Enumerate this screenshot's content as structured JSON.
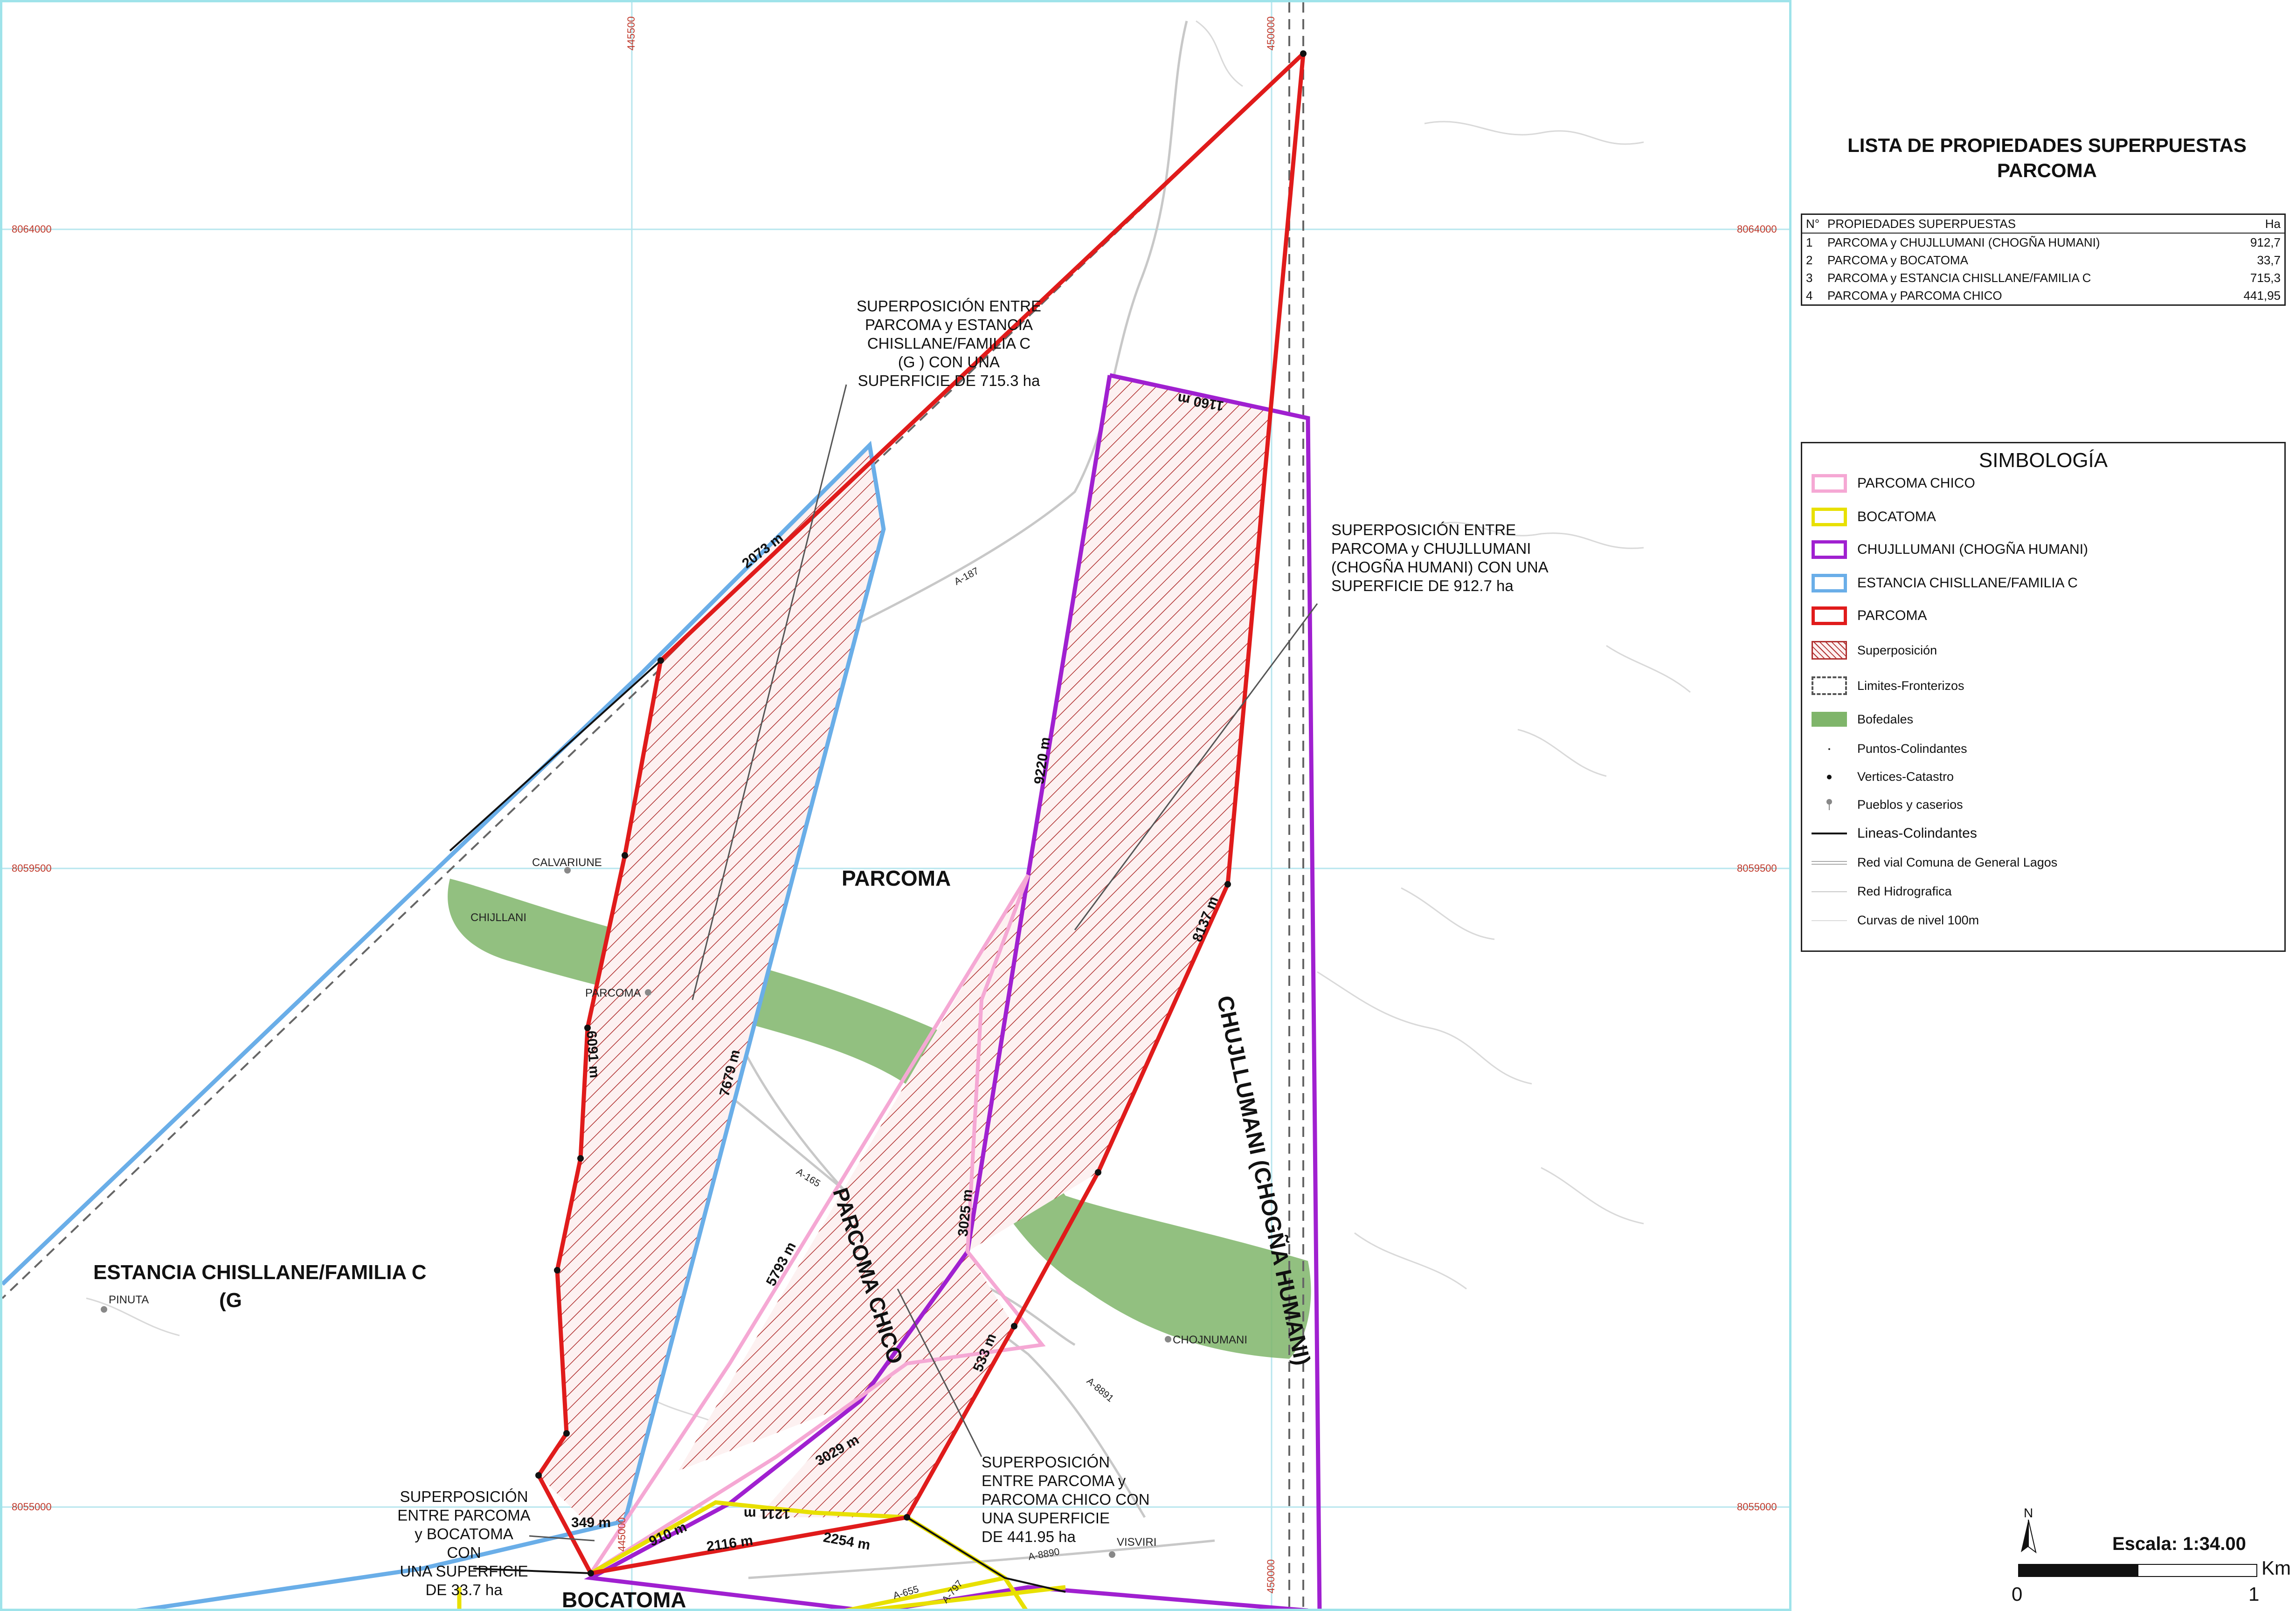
{
  "map": {
    "coords": {
      "top_445500": "445500",
      "top_450000": "450000",
      "bottom_450000": "450000",
      "bottom_445000": "445000",
      "left_8064000": "8064000",
      "right_8064000": "8064000",
      "left_8059500": "8059500",
      "right_8059500": "8059500",
      "left_8055000": "8055000",
      "right_8055000": "8055000"
    },
    "regions": {
      "parcoma": "PARCOMA",
      "parcoma_chico": "PARCOMA CHICO",
      "chujllumani": "CHUJLLUMANI (CHOGÑA HUMANI)",
      "estancia_line1": "ESTANCIA CHISLLANE/FAMILIA C",
      "estancia_line2": "(G",
      "bocatoma": "BOCATOMA"
    },
    "places": {
      "calvariune": "CALVARIUNE",
      "chijllani": "CHIJLLANI",
      "parcoma_town": "PARCOMA",
      "pinuta": "PINUTA",
      "chojnumani": "CHOJNUMANI",
      "visviri": "VISVIRI"
    },
    "roads": {
      "a187": "A-187",
      "a165": "A-165",
      "a8891": "A-8891",
      "a8890": "A-8890",
      "a655": "A-655",
      "a797": "A-797"
    },
    "dimensions": {
      "d1160": "1160 m",
      "d2073": "2073 m",
      "d9220": "9220 m",
      "d8137": "8137 m",
      "d6091": "6091 m",
      "d7679": "7679 m",
      "d3025": "3025 m",
      "d5793": "5793 m",
      "d533": "533 m",
      "d3029": "3029 m",
      "d1211": "1211 m",
      "d910": "910 m",
      "d2116": "2116 m",
      "d2254": "2254 m",
      "d349": "349 m"
    },
    "notes": {
      "estancia": [
        "SUPERPOSICIÓN ENTRE",
        "PARCOMA y ESTANCIA",
        "CHISLLANE/FAMILIA C",
        "(G                ) CON UNA",
        "SUPERFICIE DE 715.3 ha"
      ],
      "chujllumani": [
        "SUPERPOSICIÓN ENTRE",
        "PARCOMA y CHUJLLUMANI",
        "(CHOGÑA HUMANI) CON UNA",
        "SUPERFICIE DE 912.7 ha"
      ],
      "parcoma_chico": [
        "SUPERPOSICIÓN",
        "ENTRE PARCOMA y",
        "PARCOMA CHICO CON",
        "UNA SUPERFICIE",
        "DE 441.95 ha"
      ],
      "bocatoma": [
        "SUPERPOSICIÓN",
        "ENTRE PARCOMA",
        "y BOCATOMA CON",
        "UNA SUPERFICIE",
        "DE 33.7 ha"
      ]
    },
    "colors": {
      "parcoma": "#e01b1b",
      "parcoma_chico": "#f5a8d4",
      "bocatoma": "#e8e000",
      "chujllumani": "#a020d0",
      "estancia": "#6aaee8",
      "bofedales": "#7fb56a",
      "grid": "#b7e6ee"
    }
  },
  "list": {
    "title_line1": "LISTA DE PROPIEDADES SUPERPUESTAS",
    "title_line2": "PARCOMA",
    "header": {
      "num": "N°",
      "name": "PROPIEDADES SUPERPUESTAS",
      "ha": "Ha"
    },
    "rows": [
      {
        "num": "1",
        "name": "PARCOMA y CHUJLLUMANI (CHOGÑA HUMANI)",
        "ha": "912,7"
      },
      {
        "num": "2",
        "name": "PARCOMA y BOCATOMA",
        "ha": "33,7"
      },
      {
        "num": "3",
        "name": "PARCOMA y ESTANCIA CHISLLANE/FAMILIA C",
        "ha": "715,3"
      },
      {
        "num": "4",
        "name": "PARCOMA y PARCOMA CHICO",
        "ha": "441,95"
      }
    ]
  },
  "legend": {
    "title": "SIMBOLOGÍA",
    "items": {
      "parcoma_chico": "PARCOMA CHICO",
      "bocatoma": "BOCATOMA",
      "chujllumani": "CHUJLLUMANI (CHOGÑA HUMANI)",
      "estancia": "ESTANCIA CHISLLANE/FAMILIA C",
      "parcoma": "PARCOMA",
      "superposicion": "Superposición",
      "limites": "Limites-Fronterizos",
      "bofedales": "Bofedales",
      "puntos": "Puntos-Colindantes",
      "vertices": "Vertices-Catastro",
      "pueblos": "Pueblos y caserios",
      "lineas": "Lineas-Colindantes",
      "red_vial": "Red vial Comuna de General Lagos",
      "red_hidro": "Red Hidrografica",
      "curvas": "Curvas de nivel 100m"
    }
  },
  "scale": {
    "north": "N",
    "title": "Escala: 1:34.00",
    "start": "0",
    "end": "1",
    "unit": "Km"
  }
}
